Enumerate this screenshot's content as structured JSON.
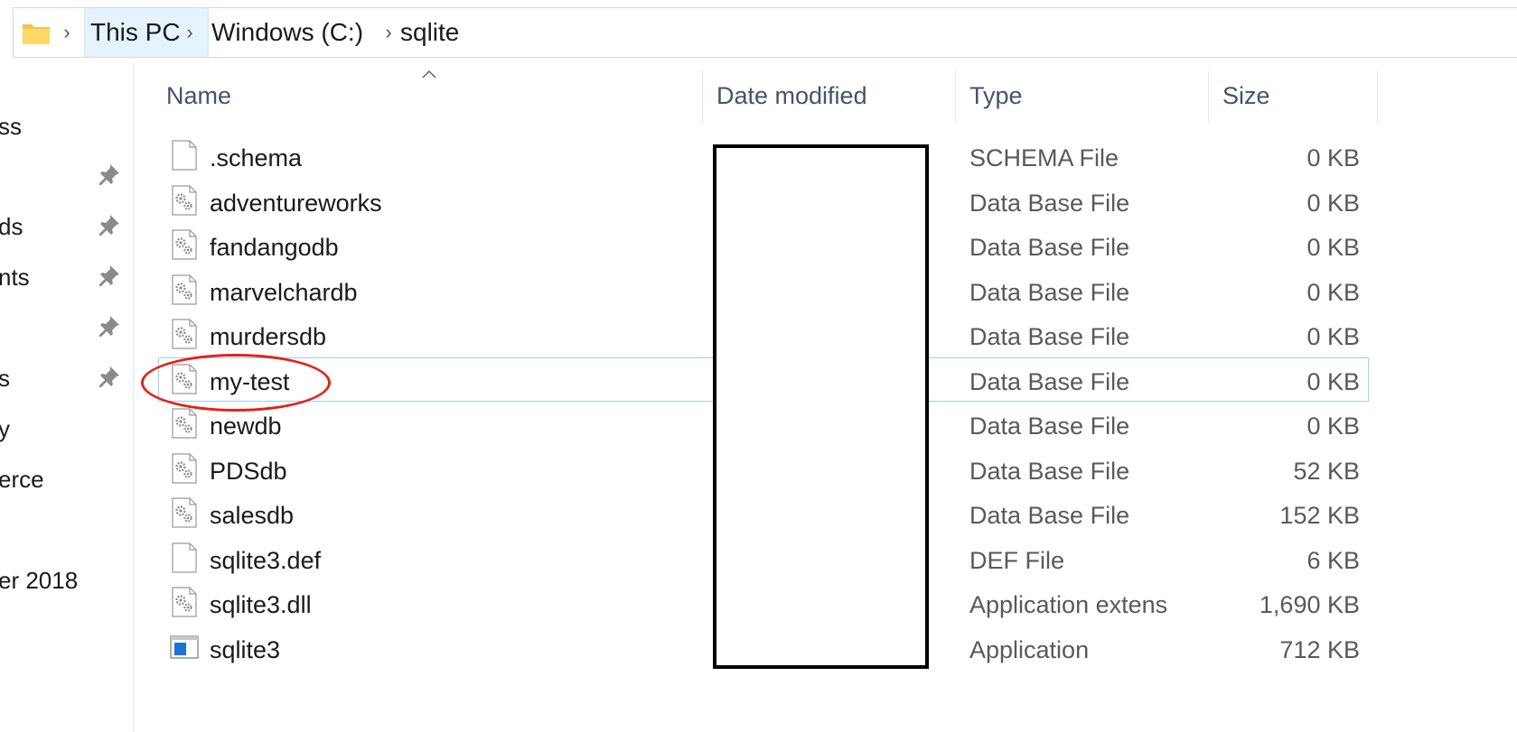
{
  "breadcrumb": {
    "items": [
      "This PC",
      "Windows (C:)",
      "sqlite"
    ]
  },
  "navpane": {
    "items": [
      "ss",
      "ds",
      "nts",
      "s",
      "y",
      "erce",
      "er 2018"
    ]
  },
  "columns": {
    "name": "Name",
    "date": "Date modified",
    "type": "Type",
    "size": "Size"
  },
  "files": [
    {
      "name": ".schema",
      "type": "SCHEMA File",
      "size": "0 KB",
      "icon": "blank-file-icon"
    },
    {
      "name": "adventureworks",
      "type": "Data Base File",
      "size": "0 KB",
      "icon": "settings-file-icon"
    },
    {
      "name": "fandangodb",
      "type": "Data Base File",
      "size": "0 KB",
      "icon": "settings-file-icon"
    },
    {
      "name": "marvelchardb",
      "type": "Data Base File",
      "size": "0 KB",
      "icon": "settings-file-icon"
    },
    {
      "name": "murdersdb",
      "type": "Data Base File",
      "size": "0 KB",
      "icon": "settings-file-icon"
    },
    {
      "name": "my-test",
      "type": "Data Base File",
      "size": "0 KB",
      "icon": "settings-file-icon",
      "selected": true
    },
    {
      "name": "newdb",
      "type": "Data Base File",
      "size": "0 KB",
      "icon": "settings-file-icon"
    },
    {
      "name": "PDSdb",
      "type": "Data Base File",
      "size": "52 KB",
      "icon": "settings-file-icon"
    },
    {
      "name": "salesdb",
      "type": "Data Base File",
      "size": "152 KB",
      "icon": "settings-file-icon"
    },
    {
      "name": "sqlite3.def",
      "type": "DEF File",
      "size": "6 KB",
      "icon": "blank-file-icon"
    },
    {
      "name": "sqlite3.dll",
      "type": "Application extens",
      "size": "1,690 KB",
      "icon": "settings-file-icon"
    },
    {
      "name": "sqlite3",
      "type": "Application",
      "size": "712 KB",
      "icon": "application-icon"
    }
  ],
  "colors": {
    "selection_border": "#99d1ff",
    "breadcrumb_highlight": "#e5f3ff",
    "annotation_circle": "#e2231a",
    "header_text": "#44546a"
  }
}
